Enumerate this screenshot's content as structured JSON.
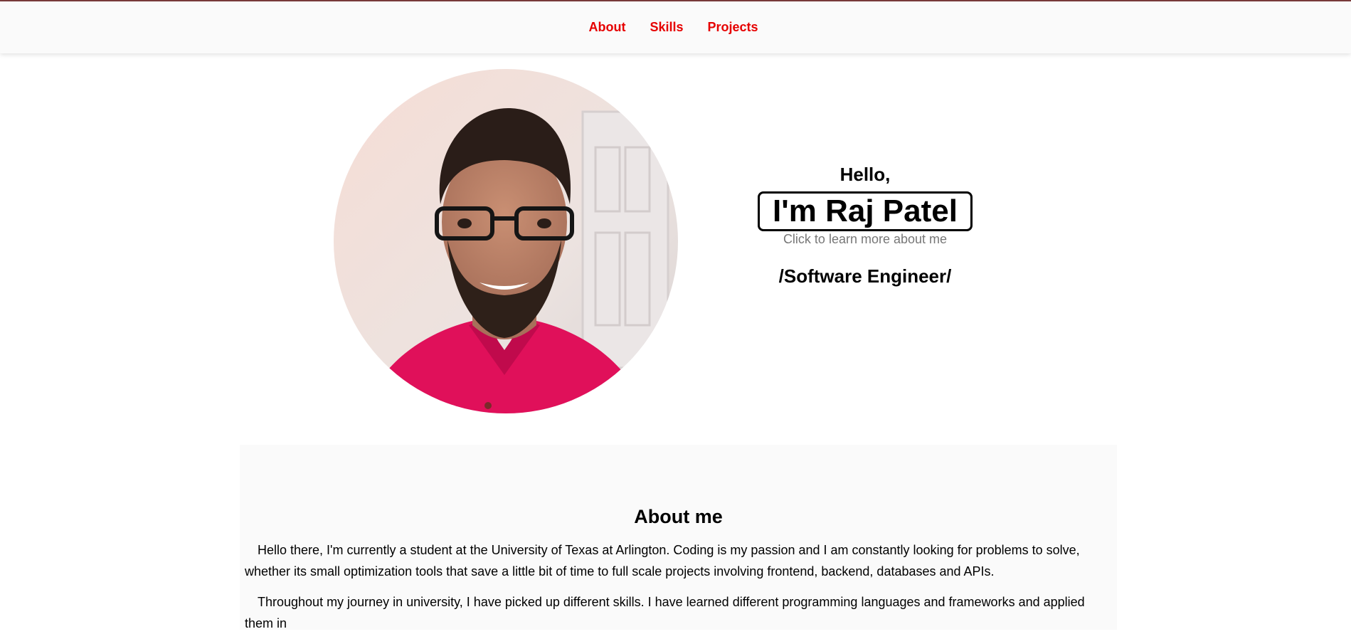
{
  "nav": {
    "items": [
      {
        "label": "About"
      },
      {
        "label": "Skills"
      },
      {
        "label": "Projects"
      }
    ]
  },
  "hero": {
    "greeting": "Hello,",
    "name": "I'm Raj Patel",
    "hint": "Click to learn more about me",
    "role": "/Software Engineer/"
  },
  "about": {
    "title": "About me",
    "paragraphs": [
      "Hello there, I'm currently a student at the University of Texas at Arlington. Coding is my passion and I am constantly looking for problems to solve, whether its small optimization tools that save a little bit of time to full scale projects involving frontend, backend, databases and APIs.",
      "Throughout my journey in university, I have picked up different skills. I have learned different programming languages and frameworks and applied them in"
    ]
  },
  "colors": {
    "accent": "#e60000",
    "navbar_bg": "#fafafa",
    "section_bg": "#fafafa"
  }
}
